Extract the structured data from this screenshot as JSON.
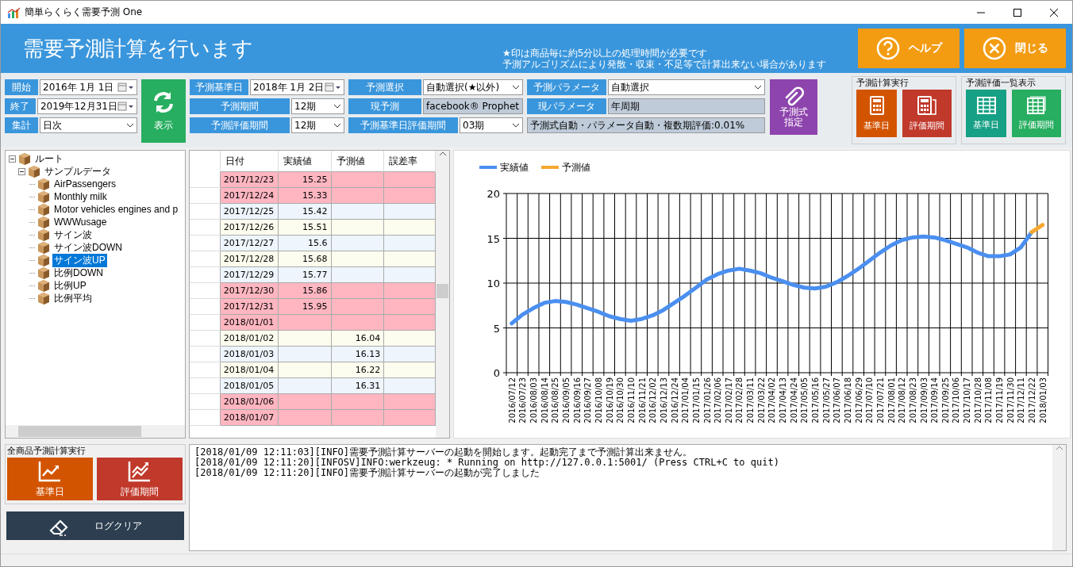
{
  "window": {
    "title": "簡単らくらく需要予測 One"
  },
  "header": {
    "title": "需要予測計算を行います",
    "notes": [
      "★印は商品毎に約5分以上の処理時間が必要です",
      "予測アルゴリズムにより発散・収束・不足等で計算出来ない場合があります"
    ],
    "buttons": [
      {
        "label": "ヘルプ",
        "kind": "help"
      },
      {
        "label": "閉じる",
        "kind": "close"
      }
    ]
  },
  "period_fields": [
    {
      "label": "開始",
      "value": "2016年  1月  1日",
      "kind": "date"
    },
    {
      "label": "終了",
      "value": "2019年12月31日",
      "kind": "date"
    },
    {
      "label": "集計",
      "value": "日次",
      "kind": "select"
    }
  ],
  "refresh_button": "表示",
  "forecast_fields": [
    [
      {
        "label": "予測基準日",
        "value": "2018年  1月  2日",
        "kind": "date"
      },
      {
        "label": "予測期間",
        "value": "12期",
        "kind": "select"
      },
      {
        "label": "予測評価期間",
        "value": "12期",
        "kind": "select"
      }
    ],
    [
      {
        "label": "予測選択",
        "value": "自動選択(★以外)",
        "kind": "select"
      },
      {
        "label": "現予測",
        "value": "facebook® Prophet",
        "kind": "readonly"
      },
      {
        "label": "予測基準日評価期間",
        "value": "03期",
        "kind": "select"
      }
    ],
    [
      {
        "label": "予測パラメータ",
        "value": "自動選択",
        "kind": "select"
      },
      {
        "label": "現パラメータ",
        "value": "年周期",
        "kind": "readonly"
      },
      {
        "value": "予測式自動・パラメータ自動・複数期評価:0.01%",
        "kind": "readonly"
      }
    ]
  ],
  "formula_button": [
    "予測式",
    "指定"
  ],
  "button_groups": [
    {
      "title": "予測計算実行",
      "buttons": [
        {
          "label": "基準日",
          "color": "#d35400"
        },
        {
          "label": "評価期間",
          "color": "#c0392b"
        }
      ]
    },
    {
      "title": "予測評価一覧表示",
      "buttons": [
        {
          "label": "基準日",
          "color": "#16a085"
        },
        {
          "label": "評価期間",
          "color": "#27ae60"
        }
      ]
    }
  ],
  "tree": {
    "label": "ルート",
    "expanded": true,
    "children": [
      {
        "label": "サンプルデータ",
        "expanded": true,
        "children": [
          {
            "label": "AirPassengers",
            "selected": false
          },
          {
            "label": "Monthly milk",
            "selected": false
          },
          {
            "label": "Motor vehicles engines and p",
            "selected": false
          },
          {
            "label": "WWWusage",
            "selected": false
          },
          {
            "label": "サイン波",
            "selected": false
          },
          {
            "label": "サイン波DOWN",
            "selected": false
          },
          {
            "label": "サイン波UP",
            "selected": true
          },
          {
            "label": "比例DOWN",
            "selected": false
          },
          {
            "label": "比例UP",
            "selected": false
          },
          {
            "label": "比例平均",
            "selected": false
          }
        ]
      }
    ]
  },
  "table": {
    "columns": [
      "日付",
      "実績値",
      "予測値",
      "誤差率"
    ],
    "rows": [
      {
        "kind": "holiday",
        "cells": [
          "2017/12/23",
          "15.25",
          "",
          ""
        ]
      },
      {
        "kind": "holiday",
        "cells": [
          "2017/12/24",
          "15.33",
          "",
          ""
        ]
      },
      {
        "kind": "weekday",
        "cells": [
          "2017/12/25",
          "15.42",
          "",
          ""
        ]
      },
      {
        "kind": "weekday",
        "cells": [
          "2017/12/26",
          "15.51",
          "",
          ""
        ]
      },
      {
        "kind": "weekday",
        "cells": [
          "2017/12/27",
          "15.6",
          "",
          ""
        ]
      },
      {
        "kind": "weekday",
        "cells": [
          "2017/12/28",
          "15.68",
          "",
          ""
        ]
      },
      {
        "kind": "weekday",
        "cells": [
          "2017/12/29",
          "15.77",
          "",
          ""
        ]
      },
      {
        "kind": "holiday",
        "cells": [
          "2017/12/30",
          "15.86",
          "",
          ""
        ]
      },
      {
        "kind": "holiday",
        "cells": [
          "2017/12/31",
          "15.95",
          "",
          ""
        ]
      },
      {
        "kind": "holiday",
        "cells": [
          "2018/01/01",
          "",
          "",
          ""
        ]
      },
      {
        "kind": "weekday",
        "cells": [
          "2018/01/02",
          "",
          "16.04",
          ""
        ]
      },
      {
        "kind": "weekday",
        "cells": [
          "2018/01/03",
          "",
          "16.13",
          ""
        ]
      },
      {
        "kind": "weekday",
        "cells": [
          "2018/01/04",
          "",
          "16.22",
          ""
        ]
      },
      {
        "kind": "weekday",
        "cells": [
          "2018/01/05",
          "",
          "16.31",
          ""
        ]
      },
      {
        "kind": "holiday",
        "cells": [
          "2018/01/06",
          "",
          "",
          ""
        ]
      },
      {
        "kind": "holiday",
        "cells": [
          "2018/01/07",
          "",
          "",
          ""
        ]
      }
    ]
  },
  "chart": {
    "chart_data": {
      "type": "line",
      "categories": [
        "2016/07/12",
        "2016/07/23",
        "2016/08/03",
        "2016/08/14",
        "2016/08/25",
        "2016/09/05",
        "2016/09/16",
        "2016/09/27",
        "2016/10/08",
        "2016/10/19",
        "2016/10/30",
        "2016/11/10",
        "2016/11/21",
        "2016/12/02",
        "2016/12/13",
        "2016/12/24",
        "2017/01/04",
        "2017/01/15",
        "2017/01/26",
        "2017/02/06",
        "2017/02/17",
        "2017/02/28",
        "2017/03/11",
        "2017/03/22",
        "2017/04/02",
        "2017/04/13",
        "2017/04/24",
        "2017/05/05",
        "2017/05/16",
        "2017/05/27",
        "2017/06/07",
        "2017/06/18",
        "2017/06/29",
        "2017/07/10",
        "2017/07/21",
        "2017/08/01",
        "2017/08/12",
        "2017/08/23",
        "2017/09/03",
        "2017/09/14",
        "2017/09/25",
        "2017/10/06",
        "2017/10/17",
        "2017/10/28",
        "2017/11/08",
        "2017/11/19",
        "2017/11/30",
        "2017/12/11",
        "2017/12/22",
        "2018/01/03"
      ],
      "series": [
        {
          "name": "実績値",
          "color": "#4a8ff0",
          "values": [
            5.5,
            6.5,
            7.2,
            7.8,
            8.0,
            7.9,
            7.6,
            7.2,
            6.8,
            6.3,
            6.0,
            5.8,
            6.0,
            6.4,
            7.0,
            7.8,
            8.6,
            9.5,
            10.4,
            11.0,
            11.4,
            11.6,
            11.4,
            11.1,
            10.6,
            10.2,
            9.8,
            9.5,
            9.4,
            9.6,
            10.1,
            10.8,
            11.6,
            12.5,
            13.4,
            14.2,
            14.8,
            15.1,
            15.2,
            15.1,
            14.8,
            14.4,
            14.0,
            13.4,
            13.0,
            13.0,
            13.2,
            14.0,
            15.7,
            null
          ]
        },
        {
          "name": "予測値",
          "color": "#f5a830",
          "values": [
            null,
            null,
            null,
            null,
            null,
            null,
            null,
            null,
            null,
            null,
            null,
            null,
            null,
            null,
            null,
            null,
            null,
            null,
            null,
            null,
            null,
            null,
            null,
            null,
            null,
            null,
            null,
            null,
            null,
            null,
            null,
            null,
            null,
            null,
            null,
            null,
            null,
            null,
            null,
            null,
            null,
            null,
            null,
            null,
            null,
            null,
            null,
            null,
            15.7,
            16.5
          ]
        }
      ],
      "grid": true,
      "legend": true,
      "ylim": [
        0,
        20
      ],
      "yticks": [
        0,
        5,
        10,
        15,
        20
      ]
    }
  },
  "all_products": {
    "title": "全商品予測計算実行",
    "buttons": [
      {
        "label": "基準日",
        "color": "#d35400"
      },
      {
        "label": "評価期間",
        "color": "#c0392b"
      }
    ]
  },
  "clear_button": "ログクリア",
  "log": [
    "[2018/01/09 12:11:03][INFO]需要予測計算サーバーの起動を開始します。起動完了まで予測計算出来ません。",
    "[2018/01/09 12:11:20][INFOSV]INFO:werkzeug: * Running on http://127.0.0.1:5001/ (Press CTRL+C to quit)",
    "[2018/01/09 12:11:20][INFO]需要予測計算サーバーの起動が完了しました"
  ]
}
